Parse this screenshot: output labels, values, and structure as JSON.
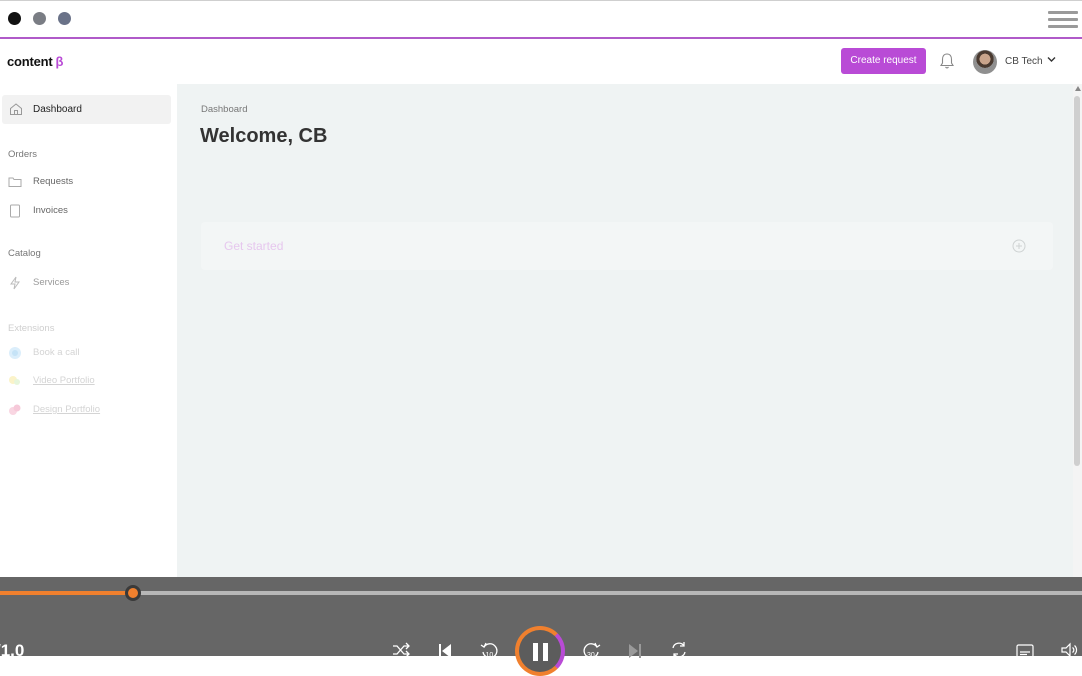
{
  "window": {
    "controls": [
      "close-dot",
      "minimize-dot",
      "maximize-dot"
    ],
    "menu_icon": "hamburger-icon"
  },
  "header": {
    "logo_text": "content",
    "logo_beta": "β",
    "create_button_label": "Create request",
    "notification_icon": "bell-icon",
    "user_name": "CB Tech"
  },
  "sidebar": {
    "dashboard_label": "Dashboard",
    "sections": {
      "orders": "Orders",
      "catalog": "Catalog",
      "extensions": "Extensions"
    },
    "items": {
      "requests": "Requests",
      "invoices": "Invoices",
      "services": "Services",
      "book_call": "Book a call",
      "video_portfolio": "Video Portfolio",
      "design_portfolio": "Design Portfolio"
    }
  },
  "main": {
    "breadcrumb": "Dashboard",
    "title": "Welcome, CB",
    "card_title": "Get started"
  },
  "player": {
    "speed": "/1.0",
    "progress_fraction": 0.123,
    "controls": [
      "shuffle-icon",
      "previous-icon",
      "rewind-10-icon",
      "pause-icon",
      "forward-30-icon",
      "next-icon",
      "repeat-icon",
      "captions-icon",
      "volume-icon"
    ],
    "rewind_label": "10",
    "forward_label": "30"
  },
  "colors": {
    "accent": "#b94bd6",
    "progress": "#f0802e",
    "player_bg": "#666666",
    "main_bg": "#eff3f3"
  }
}
